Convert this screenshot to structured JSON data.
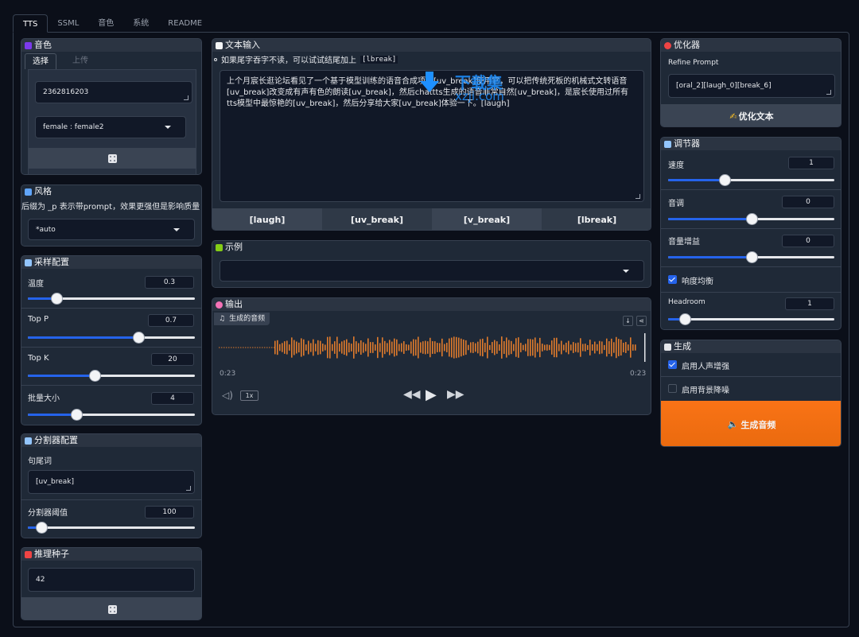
{
  "tabs": [
    "TTS",
    "SSML",
    "音色",
    "系统",
    "README"
  ],
  "voice": {
    "title": "音色",
    "subtabs": [
      "选择",
      "上传"
    ],
    "id_value": "2362816203",
    "preset": "female : female2"
  },
  "style": {
    "title": "风格",
    "note": "后缀为 _p 表示带prompt，效果更强但是影响质量",
    "value": "*auto"
  },
  "sampling": {
    "title": "采样配置",
    "temperature_label": "温度",
    "temperature": "0.3",
    "temperature_pos": 0.17,
    "top_p_label": "Top P",
    "top_p": "0.7",
    "top_p_pos": 0.66,
    "top_k_label": "Top K",
    "top_k": "20",
    "top_k_pos": 0.4,
    "batch_label": "批量大小",
    "batch": "4",
    "batch_pos": 0.29
  },
  "splitter": {
    "title": "分割器配置",
    "eos_label": "句尾词",
    "eos_value": "[uv_break]",
    "threshold_label": "分割器阈值",
    "threshold": "100",
    "threshold_pos": 0.08
  },
  "seed": {
    "title": "推理种子",
    "value": "42"
  },
  "text_input": {
    "title": "文本输入",
    "hint": "如果尾字吞字不读，可以试试结尾加上",
    "hint_code": "[lbreak]",
    "content": "上个月宸长逛论坛看见了一个基于模型训练的语音合成项目[uv_break]使用它，可以把传统死板的机械式文转语音[uv_break]改变成有声有色的朗读[uv_break]，然后chattts生成的语音非常自然[uv_break]，是宸长使用过所有tts模型中最惊艳的[uv_break]，然后分享给大家[uv_break]体验一下。[laugh]",
    "buttons": [
      "[laugh]",
      "[uv_break]",
      "[v_break]",
      "[lbreak]"
    ]
  },
  "examples": {
    "title": "示例"
  },
  "output": {
    "title": "输出",
    "audio_label": "生成的音频",
    "time_start": "0:23",
    "time_end": "0:23",
    "speed": "1x"
  },
  "optimizer": {
    "title": "优化器",
    "refine_label": "Refine Prompt",
    "refine_value": "[oral_2][laugh_0][break_6]",
    "button": "优化文本"
  },
  "adjuster": {
    "title": "调节器",
    "speed_label": "速度",
    "speed": "1",
    "speed_pos": 0.34,
    "pitch_label": "音调",
    "pitch": "0",
    "pitch_pos": 0.5,
    "volume_label": "音量增益",
    "volume": "0",
    "volume_pos": 0.5,
    "loudness_label": "响度均衡",
    "loudness_on": true,
    "headroom_label": "Headroom",
    "headroom": "1",
    "headroom_pos": 0.1
  },
  "generate": {
    "title": "生成",
    "enhance_label": "启用人声增强",
    "enhance_on": true,
    "denoise_label": "启用背景降噪",
    "denoise_on": false,
    "button": "生成音频"
  },
  "watermark": {
    "line1": "下载集",
    "line2": "xzji.com"
  },
  "colors": {
    "accent": "#2563eb",
    "orange": "#f97316",
    "wave": "#e07b2c"
  }
}
